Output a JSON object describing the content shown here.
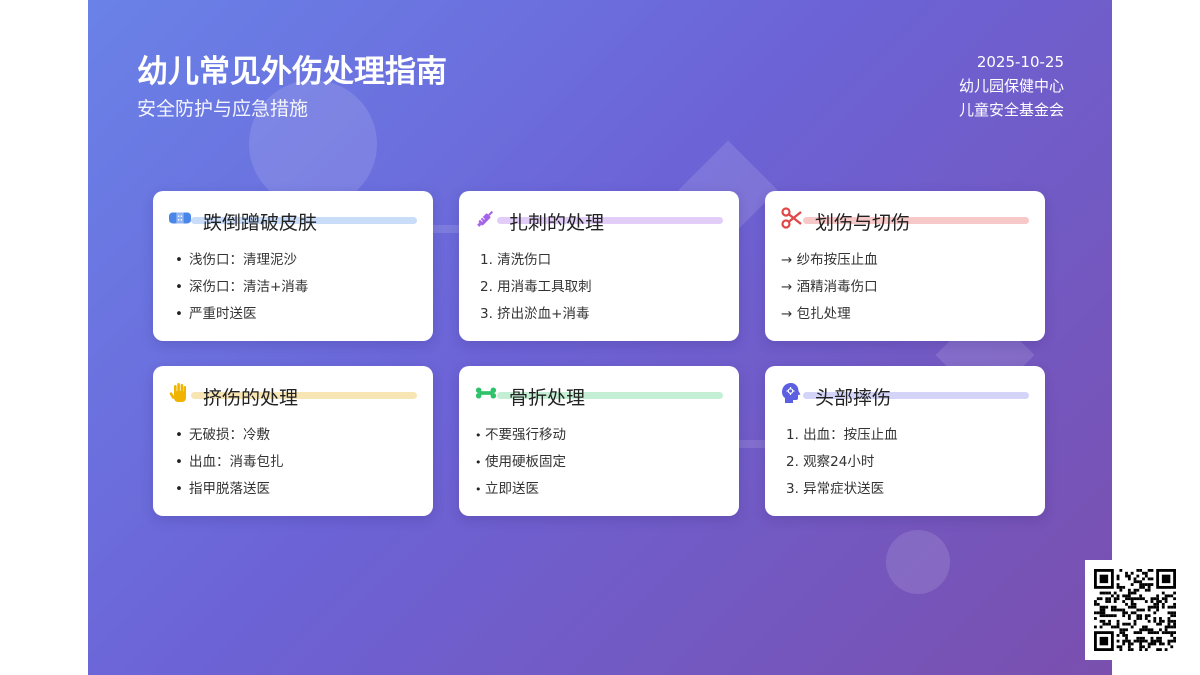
{
  "header": {
    "title": "幼儿常见外伤处理指南",
    "subtitle": "安全防护与应急措施",
    "date": "2025-10-25",
    "org1": "幼儿园保健中心",
    "org2": "儿童安全基金会"
  },
  "cards": [
    {
      "title": "跌倒蹭破皮肤",
      "icon": "bandage-icon",
      "accent": "#4a86e8",
      "line": "#c9dcf8",
      "items": [
        "浅伤口：清理泥沙",
        "深伤口：清洁+消毒",
        "严重时送医"
      ]
    },
    {
      "title": "扎刺的处理",
      "icon": "syringe-icon",
      "accent": "#a463e8",
      "line": "#e2cdf8",
      "items": [
        "1. 清洗伤口",
        "2. 用消毒工具取刺",
        "3. 挤出淤血+消毒"
      ]
    },
    {
      "title": "划伤与切伤",
      "icon": "scissors-icon",
      "accent": "#e04848",
      "line": "#f7c8c8",
      "items": [
        "→ 纱布按压止血",
        "→ 酒精消毒伤口",
        "→ 包扎处理"
      ]
    },
    {
      "title": "挤伤的处理",
      "icon": "hand-icon",
      "accent": "#f0b400",
      "line": "#f8e5b4",
      "items": [
        "无破损：冷敷",
        "出血：消毒包扎",
        "指甲脱落送医"
      ]
    },
    {
      "title": "骨折处理",
      "icon": "bone-icon",
      "accent": "#2ec26a",
      "line": "#c4efd4",
      "items": [
        "不要强行移动",
        "使用硬板固定",
        "立即送医"
      ]
    },
    {
      "title": "头部摔伤",
      "icon": "head-icon",
      "accent": "#5b5fe0",
      "line": "#d3d4f8",
      "items": [
        "1. 出血：按压止血",
        "2. 观察24小时",
        "3. 异常症状送医"
      ]
    }
  ]
}
